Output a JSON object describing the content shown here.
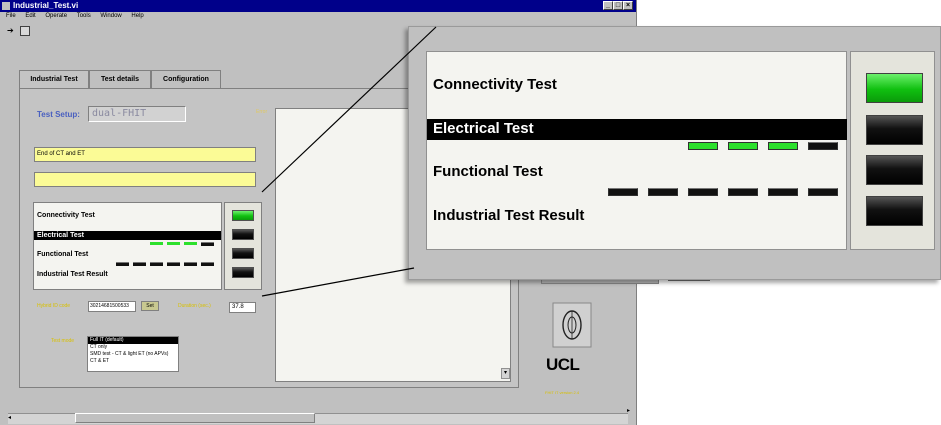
{
  "window": {
    "title": "Industrial_Test.vi"
  },
  "menu": [
    "File",
    "Edit",
    "Operate",
    "Tools",
    "Window",
    "Help"
  ],
  "tabs": [
    {
      "label": "Industrial Test"
    },
    {
      "label": "Test details"
    },
    {
      "label": "Configuration"
    }
  ],
  "setup": {
    "label": "Test Setup:",
    "value": "dual-FHIT"
  },
  "error_label": "Error",
  "messages": [
    "End of CT and ET",
    ""
  ],
  "tests": {
    "connectivity": "Connectivity Test",
    "electrical": "Electrical Test",
    "functional": "Functional Test",
    "result": "Industrial Test Result"
  },
  "leds": {
    "connectivity": "green",
    "electrical": "black",
    "functional": "black",
    "result": "black",
    "electrical_sub": [
      "green",
      "green",
      "green",
      "black"
    ],
    "functional_sub": [
      "black",
      "black",
      "black",
      "black",
      "black",
      "black"
    ]
  },
  "hybrid": {
    "label": "Hybrid ID code",
    "value": "30214681500533",
    "button": "Set"
  },
  "duration": {
    "label": "Duration (sec.)",
    "value": "37.8"
  },
  "test_mode": {
    "label": "Test mode",
    "options": [
      "Full IT (default)",
      "CT only",
      "SMD test - CT & light ET (no APVs)",
      "CT & ET"
    ],
    "selected_index": 0
  },
  "logo": {
    "text": "UCL",
    "version": "FHIT IT version 2.4"
  },
  "colors": {
    "titlebar": "#00008a",
    "led_green": "#10c010",
    "message_bg": "#fbfb96",
    "label_yellow": "#d8c000"
  }
}
